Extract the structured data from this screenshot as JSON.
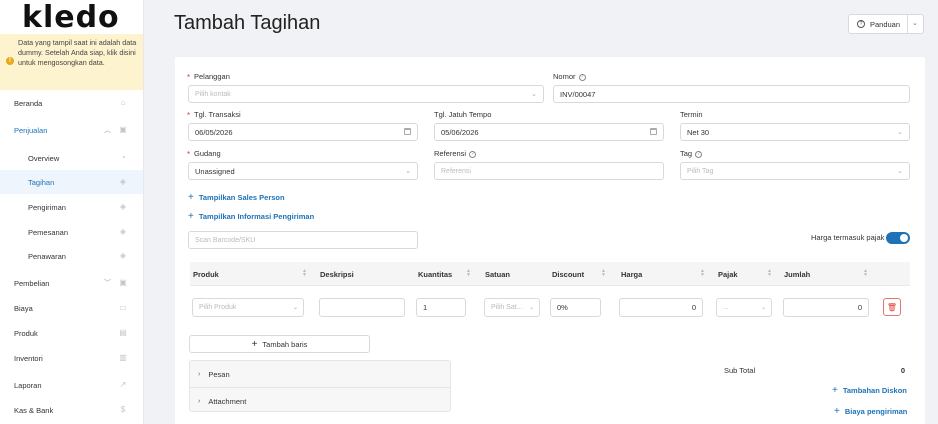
{
  "sidebar": {
    "logo": "kledo",
    "notice": "Data yang tampil saat ini adalah data dummy. Setelah Anda siap, klik disini untuk mengosongkan data.",
    "items": [
      {
        "label": "Beranda",
        "icon": "home-icon"
      },
      {
        "label": "Penjualan",
        "icon": "basket-icon"
      },
      {
        "label": "Overview",
        "icon": "pie-icon"
      },
      {
        "label": "Tagihan",
        "icon": "tag-icon"
      },
      {
        "label": "Pengiriman",
        "icon": "tag-icon"
      },
      {
        "label": "Pemesanan",
        "icon": "tag-icon"
      },
      {
        "label": "Penawaran",
        "icon": "tag-icon"
      },
      {
        "label": "Pembelian",
        "icon": "bag-icon"
      },
      {
        "label": "Biaya",
        "icon": "wallet-icon"
      },
      {
        "label": "Produk",
        "icon": "box-icon"
      },
      {
        "label": "Inventori",
        "icon": "archive-icon"
      },
      {
        "label": "Laporan",
        "icon": "chart-icon"
      },
      {
        "label": "Kas & Bank",
        "icon": "dollar-icon"
      }
    ]
  },
  "header": {
    "title": "Tambah Tagihan",
    "guide_label": "Panduan"
  },
  "form": {
    "pelanggan_label": "Pelanggan",
    "pelanggan_placeholder": "Pilih kontak",
    "nomor_label": "Nomor",
    "nomor_value": "INV/00047",
    "tgl_transaksi_label": "Tgl. Transaksi",
    "tgl_transaksi_value": "06/05/2026",
    "tgl_jatuh_tempo_label": "Tgl. Jatuh Tempo",
    "tgl_jatuh_tempo_value": "05/06/2026",
    "termin_label": "Termin",
    "termin_value": "Net 30",
    "gudang_label": "Gudang",
    "gudang_value": "Unassigned",
    "referensi_label": "Referensi",
    "referensi_placeholder": "Referensi",
    "tag_label": "Tag",
    "tag_placeholder": "Pilih Tag",
    "show_sales_person": "Tampilkan Sales Person",
    "show_shipping_info": "Tampilkan Informasi Pengiriman",
    "scan_placeholder": "Scan Barcode/SKU",
    "tax_inclusive_label": "Harga termasuk pajak"
  },
  "table": {
    "headers": [
      "Produk",
      "Deskripsi",
      "Kuantitas",
      "Satuan",
      "Discount",
      "Harga",
      "Pajak",
      "Jumlah"
    ],
    "row": {
      "produk_placeholder": "Pilih Produk",
      "deskripsi": "",
      "kuantitas": "1",
      "satuan_placeholder": "Pilih Sat...",
      "discount": "0%",
      "harga": "0",
      "pajak": "...",
      "jumlah": "0"
    },
    "add_row_label": "Tambah baris"
  },
  "collapse": {
    "items": [
      "Pesan",
      "Attachment"
    ]
  },
  "summary": {
    "subtotal_label": "Sub Total",
    "subtotal_value": "0",
    "add_discount": "Tambahan Diskon",
    "shipping_cost": "Biaya pengiriman"
  },
  "colors": {
    "accent": "#1d72b8",
    "notice_bg": "#fdf3cf",
    "danger": "#e53935"
  }
}
